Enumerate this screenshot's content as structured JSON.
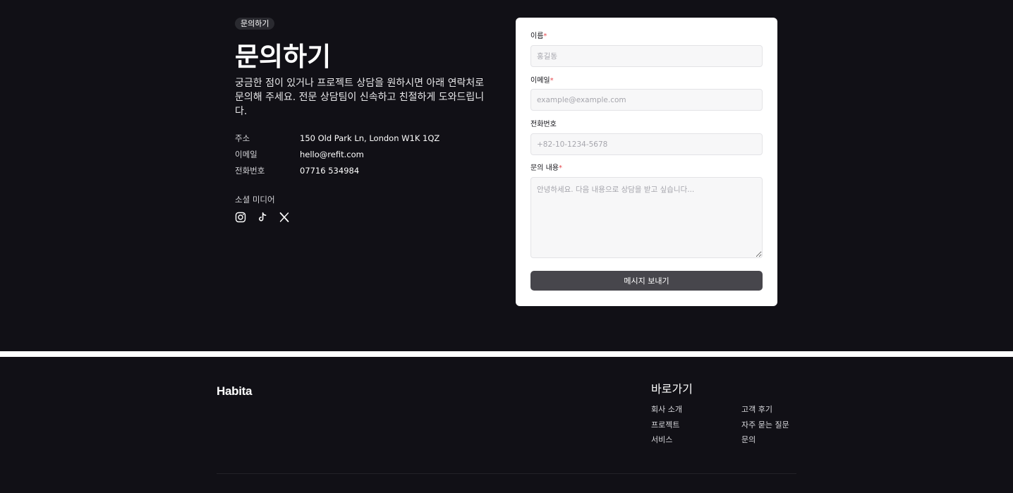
{
  "contact": {
    "badge": "문의하기",
    "title": "문의하기",
    "intro": "궁금한 점이 있거나 프로젝트 상담을 원하시면 아래 연락처로 문의해 주세요. 전문 상담팀이 신속하고 친절하게 도와드립니다.",
    "info": [
      {
        "label": "주소",
        "value": "150 Old Park Ln, London W1K 1QZ"
      },
      {
        "label": "이메일",
        "value": "hello@refit.com"
      },
      {
        "label": "전화번호",
        "value": "07716 534984"
      }
    ],
    "social_title": "소셜 미디어",
    "social_icons": [
      "instagram-icon",
      "tiktok-icon",
      "x-icon"
    ]
  },
  "form": {
    "name": {
      "label": "이름",
      "required_mark": "*",
      "placeholder": "홍길동",
      "value": ""
    },
    "email": {
      "label": "이메일",
      "required_mark": "*",
      "placeholder": "example@example.com",
      "value": ""
    },
    "phone": {
      "label": "전화번호",
      "placeholder": "+82-10-1234-5678",
      "value": ""
    },
    "message": {
      "label": "문의 내용",
      "required_mark": "*",
      "placeholder": "안녕하세요. 다음 내용으로 상담을 받고 싶습니다...",
      "value": ""
    },
    "submit_label": "메시지 보내기"
  },
  "footer": {
    "logo": "Habita",
    "nav_title": "바로가기",
    "links_col1": [
      "회사 소개",
      "프로젝트",
      "서비스"
    ],
    "links_col2": [
      "고객 후기",
      "자주 묻는 질문",
      "문의"
    ]
  },
  "colors": {
    "background": "#111016",
    "card": "#ffffff",
    "button": "#47464c",
    "required": "#e5484d"
  }
}
